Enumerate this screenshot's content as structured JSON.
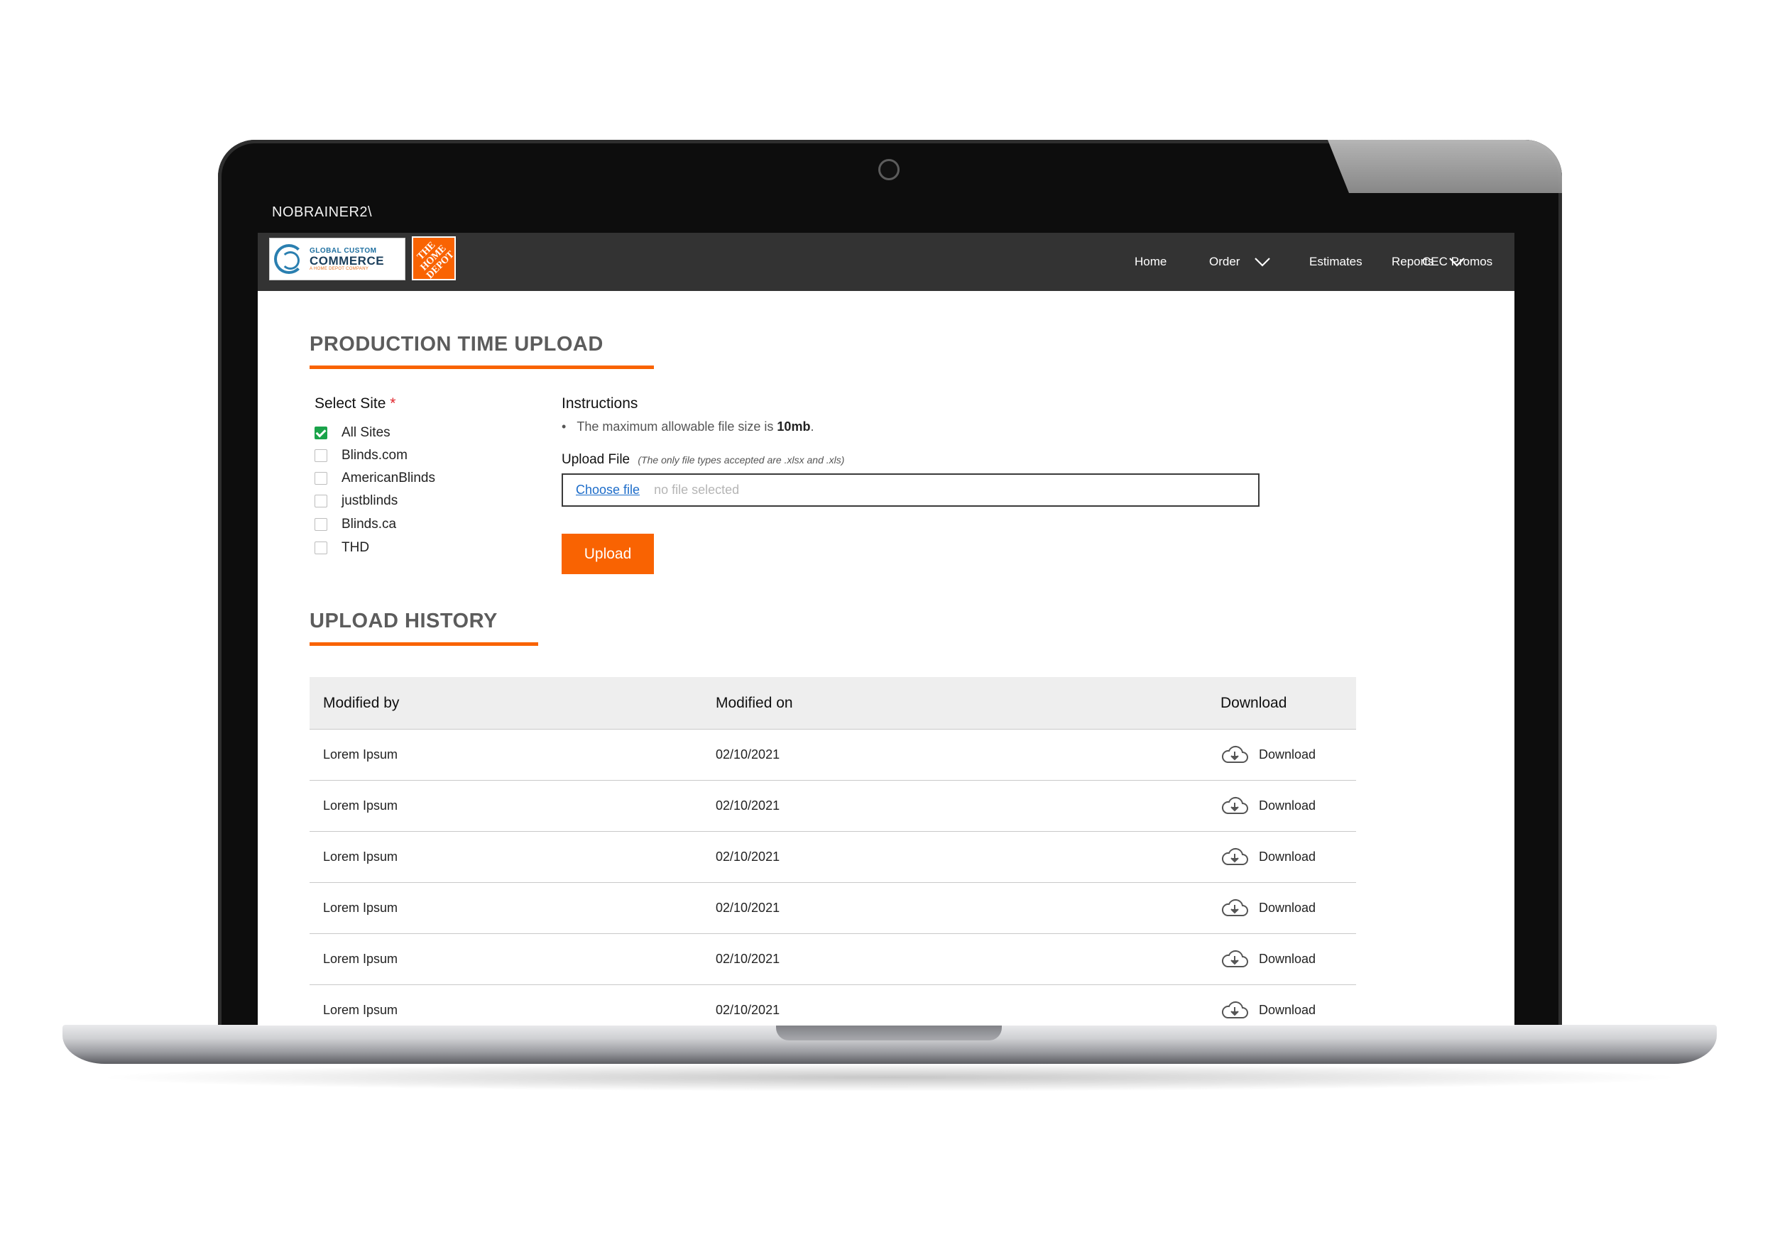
{
  "os": {
    "window_title": "NOBRAINER2\\"
  },
  "header": {
    "logo_gcc": {
      "line1": "GLOBAL CUSTOM",
      "line2": "COMMERCE",
      "line3": "A HOME DEPOT COMPANY"
    },
    "logo_hd": {
      "text": "THE HOME DEPOT"
    },
    "nav": [
      {
        "label": "Home"
      },
      {
        "label": "Order",
        "has_dropdown": true
      },
      {
        "label": "Estimates"
      },
      {
        "label": "Reports",
        "has_dropdown": true
      },
      {
        "label": "CEC Promos"
      }
    ]
  },
  "page": {
    "title": "PRODUCTION TIME UPLOAD",
    "select_site": {
      "label": "Select Site",
      "required_mark": "*",
      "options": [
        {
          "label": "All Sites",
          "checked": true
        },
        {
          "label": "Blinds.com",
          "checked": false
        },
        {
          "label": "AmericanBlinds",
          "checked": false
        },
        {
          "label": "justblinds",
          "checked": false
        },
        {
          "label": "Blinds.ca",
          "checked": false
        },
        {
          "label": "THD",
          "checked": false
        }
      ]
    },
    "instructions": {
      "heading": "Instructions",
      "bullet": "•",
      "text": "The maximum allowable file size  is ",
      "size": "10mb",
      "suffix": "."
    },
    "upload_file": {
      "label": "Upload File",
      "note": "(The only file types accepted are .xlsx and .xls)",
      "choose_label": "Choose file",
      "no_file_text": "no file selected"
    },
    "upload_button": "Upload",
    "history": {
      "title": "UPLOAD HISTORY",
      "columns": [
        "Modified by",
        "Modified on",
        "Download"
      ],
      "rows": [
        {
          "modified_by": "Lorem Ipsum",
          "modified_on": "02/10/2021",
          "download": "Download"
        },
        {
          "modified_by": "Lorem Ipsum",
          "modified_on": "02/10/2021",
          "download": "Download"
        },
        {
          "modified_by": "Lorem Ipsum",
          "modified_on": "02/10/2021",
          "download": "Download"
        },
        {
          "modified_by": "Lorem Ipsum",
          "modified_on": "02/10/2021",
          "download": "Download"
        },
        {
          "modified_by": "Lorem Ipsum",
          "modified_on": "02/10/2021",
          "download": "Download"
        },
        {
          "modified_by": "Lorem Ipsum",
          "modified_on": "02/10/2021",
          "download": "Download"
        }
      ]
    }
  },
  "colors": {
    "accent": "#f96302",
    "header_bg": "#333333",
    "check": "#1aa34a",
    "link": "#1c6cc9"
  },
  "icons": {
    "dropdown": "chevron-down-icon",
    "download": "cloud-download-icon",
    "checkbox_checked": "checkmark-icon"
  }
}
